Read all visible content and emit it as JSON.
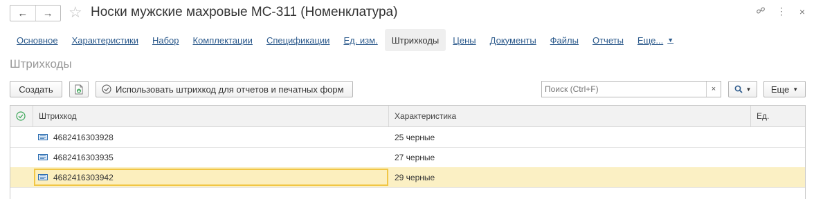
{
  "window": {
    "back_icon": "←",
    "forward_icon": "→",
    "star_icon": "☆",
    "title": "Носки мужские махровые МС-311 (Номенклатура)",
    "link_icon": "🔗",
    "more_icon": "⋮",
    "close_icon": "×"
  },
  "tabs": [
    {
      "label": "Основное"
    },
    {
      "label": "Характеристики"
    },
    {
      "label": "Набор"
    },
    {
      "label": "Комплектации"
    },
    {
      "label": "Спецификации"
    },
    {
      "label": "Ед. изм."
    },
    {
      "label": "Штрихкоды"
    },
    {
      "label": "Цены"
    },
    {
      "label": "Документы"
    },
    {
      "label": "Файлы"
    },
    {
      "label": "Отчеты"
    },
    {
      "label": "Еще..."
    }
  ],
  "section_title": "Штрихкоды",
  "toolbar": {
    "create_label": "Создать",
    "use_barcode_label": "Использовать штрихкод для отчетов и печатных форм",
    "search_placeholder": "Поиск (Ctrl+F)",
    "clear_label": "×",
    "search_icon": "🔍",
    "more_label": "Еще"
  },
  "grid": {
    "columns": [
      "Штрихкод",
      "Характеристика",
      "Ед."
    ],
    "rows": [
      {
        "barcode": "4682416303928",
        "characteristic": "25 черные",
        "unit": ""
      },
      {
        "barcode": "4682416303935",
        "characteristic": "27 черные",
        "unit": ""
      },
      {
        "barcode": "4682416303942",
        "characteristic": "29 черные",
        "unit": ""
      }
    ],
    "selected_row": 2
  },
  "colors": {
    "link": "#2c5a8c",
    "selected_row": "#fbf0c4",
    "focus_border": "#f1c645",
    "check_icon": "#3aa757"
  }
}
